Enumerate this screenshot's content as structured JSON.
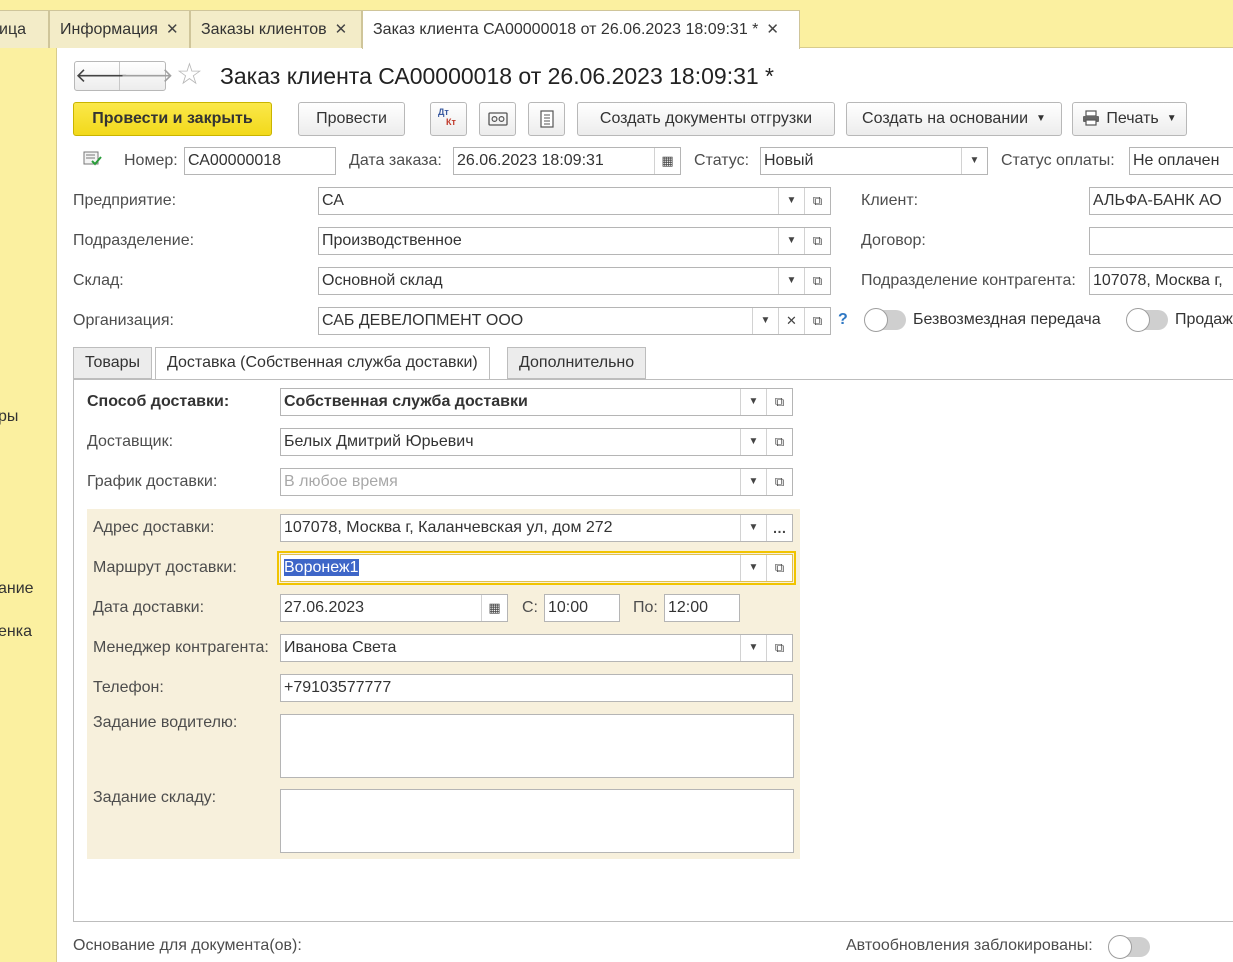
{
  "tabs": [
    {
      "label": "ица",
      "closable": false
    },
    {
      "label": "Информация",
      "closable": true
    },
    {
      "label": "Заказы клиентов",
      "closable": true
    },
    {
      "label": "Заказ клиента СА00000018 от 26.06.2023 18:09:31 *",
      "closable": true,
      "active": true
    }
  ],
  "close_glyph": "✕",
  "sidebar": {
    "items": [
      "ры",
      "ание",
      "енка"
    ]
  },
  "nav": {
    "back": "🡐",
    "forward": "🡒",
    "star": "☆"
  },
  "window": {
    "title": "Заказ клиента СА00000018 от 26.06.2023 18:09:31 *"
  },
  "toolbar": {
    "post_close": "Провести и закрыть",
    "post": "Провести",
    "dtkt_top": "Дт",
    "dtkt_bottom": "Кт",
    "create_shipment": "Создать документы отгрузки",
    "create_based": "Создать на основании",
    "print": "Печать"
  },
  "header": {
    "number_label": "Номер:",
    "number": "СА00000018",
    "date_label": "Дата заказа:",
    "date": "26.06.2023 18:09:31",
    "status_label": "Статус:",
    "status": "Новый",
    "pay_status_label": "Статус оплаты:",
    "pay_status": "Не оплачен"
  },
  "form": {
    "enterprise_label": "Предприятие:",
    "enterprise": "СА",
    "division_label": "Подразделение:",
    "division": "Производственное",
    "warehouse_label": "Склад:",
    "warehouse": "Основной склад",
    "org_label": "Организация:",
    "org": "САБ ДЕВЕЛОПМЕНТ ООО",
    "help": "?",
    "client_label": "Клиент:",
    "client": "АЛЬФА-БАНК АО",
    "contract_label": "Договор:",
    "contract": "",
    "cp_division_label": "Подразделение контрагента:",
    "cp_division": "107078, Москва г,",
    "free_transfer": "Безвозмездная передача",
    "sale": "Продаж"
  },
  "inner_tabs": [
    "Товары",
    "Доставка (Собственная служба доставки)",
    "Дополнительно"
  ],
  "delivery": {
    "method_label": "Способ доставки:",
    "method": "Собственная служба доставки",
    "courier_label": "Доставщик:",
    "courier": "Белых Дмитрий Юрьевич",
    "schedule_label": "График доставки:",
    "schedule_placeholder": "В любое время",
    "address_label": "Адрес доставки:",
    "address": "107078, Москва г, Каланчевская ул, дом 272",
    "route_label": "Маршрут доставки:",
    "route": "Воронеж1",
    "date_label": "Дата доставки:",
    "date": "27.06.2023",
    "from_label": "С:",
    "from": "10:00",
    "to_label": "По:",
    "to": "12:00",
    "manager_label": "Менеджер контрагента:",
    "manager": "Иванова Света",
    "phone_label": "Телефон:",
    "phone": "+79103577777",
    "driver_task_label": "Задание водителю:",
    "driver_task": "",
    "warehouse_task_label": "Задание складу:",
    "warehouse_task": ""
  },
  "footer": {
    "basis_label": "Основание для документа(ов):",
    "autoupdate_label": "Автообновления заблокированы:"
  },
  "colors": {
    "accent_yellow": "#f2d91b",
    "panel_bg": "#fbf0a0",
    "group_bg": "#f7f0dc",
    "focus_border": "#f1c400",
    "selection": "#3e66c8"
  }
}
